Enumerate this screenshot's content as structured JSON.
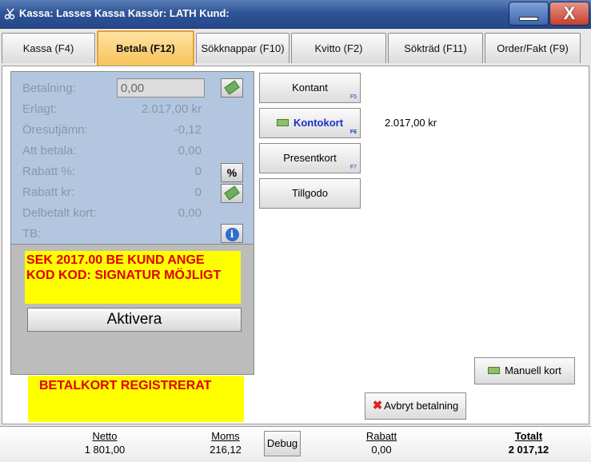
{
  "window": {
    "title": "Kassa: Lasses Kassa  Kassör: LATH  Kund:",
    "minimize_glyph": "",
    "close_glyph": "X"
  },
  "tabs": [
    {
      "label": "Kassa (F4)"
    },
    {
      "label": "Betala (F12)"
    },
    {
      "label": "Sökknappar (F10)"
    },
    {
      "label": "Kvitto (F2)"
    },
    {
      "label": "Sökträd (F11)"
    },
    {
      "label": "Order/Fakt (F9)"
    }
  ],
  "payment_info": {
    "betalning_label": "Betalning:",
    "betalning_value": "0,00",
    "erlagt_label": "Erlagt:",
    "erlagt_value": "2.017,00 kr",
    "oresutjamn_label": "Öresutjämn:",
    "oresutjamn_value": "-0,12",
    "att_betala_label": "Att betala:",
    "att_betala_value": "0,00",
    "rabatt_pct_label": "Rabatt %:",
    "rabatt_pct_value": "0",
    "rabatt_kr_label": "Rabatt kr:",
    "rabatt_kr_value": "0",
    "delbetalt_label": "Delbetalt kort:",
    "delbetalt_value": "0,00",
    "tb_label": "TB:",
    "percent_button": "%",
    "info_glyph": "i"
  },
  "messages": {
    "terminal_line1": "SEK     2017.00 BE KUND ANGE",
    "terminal_line2": "KOD KOD: SIGNATUR MÖJLIGT",
    "aktivera_label": "Aktivera",
    "status": "BETALKORT REGISTRERAT"
  },
  "payment_methods": [
    {
      "label": "Kontant",
      "fkey": "F5"
    },
    {
      "label": "Kontokort",
      "fkey": "F6"
    },
    {
      "label": "Presentkort",
      "fkey": "F7"
    },
    {
      "label": "Tillgodo",
      "fkey": ""
    }
  ],
  "card_amount": "2.017,00 kr",
  "actions": {
    "manuell_kort": "Manuell kort",
    "avbryt": "Avbryt betalning"
  },
  "footer": {
    "netto_label": "Netto",
    "netto_value": "1 801,00",
    "moms_label": "Moms",
    "moms_value": "216,12",
    "debug_label": "Debug",
    "rabatt_label": "Rabatt",
    "rabatt_value": "0,00",
    "totalt_label": "Totalt",
    "totalt_value": "2 017,12"
  },
  "colors": {
    "titlebar": "#2f5596",
    "active_tab": "#f7c35a",
    "info_panel": "#b3c6e0",
    "message_bg": "#ffff00",
    "message_text": "#e00000",
    "selected_method": "#1b2fc9"
  }
}
